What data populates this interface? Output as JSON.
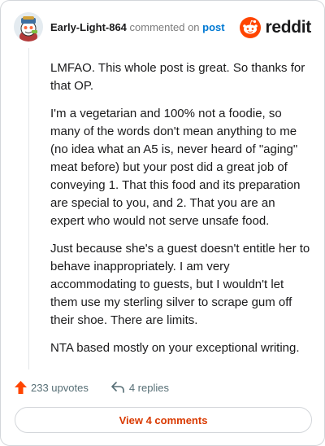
{
  "comment": {
    "username": "Early-Light-864",
    "verb": "commented on",
    "post_link": "post",
    "paragraphs": [
      "LMFAO. This whole post is great. So thanks for that OP.",
      "I'm a vegetarian and 100% not a foodie, so many of the words don't mean anything to me (no idea what an A5 is, never heard of \"aging\" meat before) but your post did a great job of conveying 1. That this food and its preparation are special to you, and 2. That you are an expert who would not serve unsafe food.",
      "Just because she's a guest doesn't entitle her to behave inappropriately. I am very accommodating to guests, but I wouldn't let them use my sterling silver to scrape gum off their shoe. There are limits.",
      "NTA based mostly on your exceptional writing."
    ],
    "upvotes": "233 upvotes",
    "replies": "4 replies",
    "view_button": "View 4 comments"
  },
  "brand": {
    "wordmark": "reddit",
    "accent_color": "#ff4500",
    "icons": [
      "avatar",
      "reddit-snoo-icon",
      "upvote-arrow-icon",
      "reply-icon"
    ]
  }
}
